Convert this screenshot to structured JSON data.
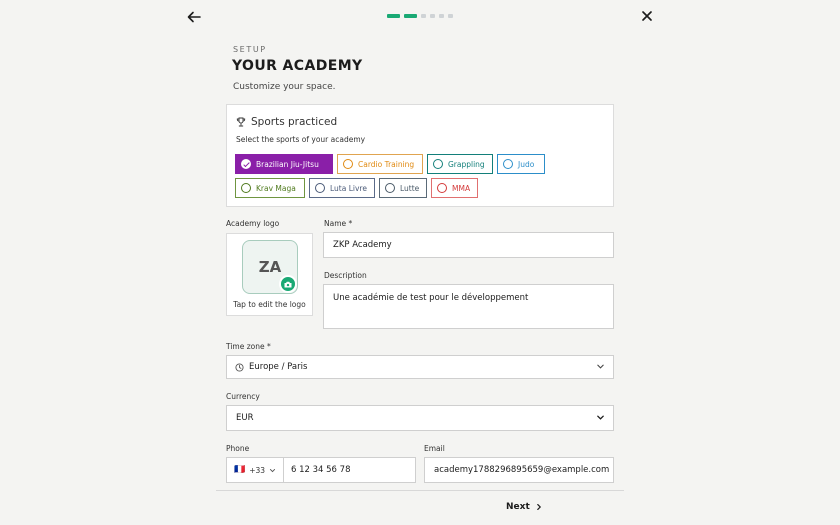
{
  "progress": {
    "total": 6,
    "active": 2
  },
  "header": {
    "eyebrow": "SETUP",
    "title": "YOUR ACADEMY",
    "subtitle": "Customize your space."
  },
  "sports": {
    "title": "Sports practiced",
    "subtitle": "Select the sports of your academy",
    "items": [
      {
        "label": "Brazilian Jiu-Jitsu",
        "color": "#8a1fa8",
        "selected": true
      },
      {
        "label": "Cardio Training",
        "color": "#e08a12",
        "selected": false
      },
      {
        "label": "Grappling",
        "color": "#137f7a",
        "selected": false
      },
      {
        "label": "Judo",
        "color": "#2c8ec9",
        "selected": false
      },
      {
        "label": "Krav Maga",
        "color": "#4f7a1d",
        "selected": false
      },
      {
        "label": "Luta Livre",
        "color": "#4a5a78",
        "selected": false
      },
      {
        "label": "Lutte",
        "color": "#4a5a68",
        "selected": false
      },
      {
        "label": "MMA",
        "color": "#d43a3a",
        "selected": false
      }
    ]
  },
  "logo": {
    "label": "Academy logo",
    "initials": "ZA",
    "caption": "Tap to edit the logo"
  },
  "name": {
    "label": "Name *",
    "value": "ZKP Academy"
  },
  "description": {
    "label": "Description",
    "value": "Une académie de test pour le développement"
  },
  "timezone": {
    "label": "Time zone *",
    "value": "Europe / Paris"
  },
  "currency": {
    "label": "Currency",
    "value": "EUR"
  },
  "phone": {
    "label": "Phone",
    "country_code": "+33",
    "flag": "🇫🇷",
    "value": "6 12 34 56 78"
  },
  "email": {
    "label": "Email",
    "value": "academy1788296895659@example.com"
  },
  "footer": {
    "next_label": "Next"
  },
  "colors": {
    "accent": "#19a974",
    "selected_sport": "#8a1fa8"
  }
}
